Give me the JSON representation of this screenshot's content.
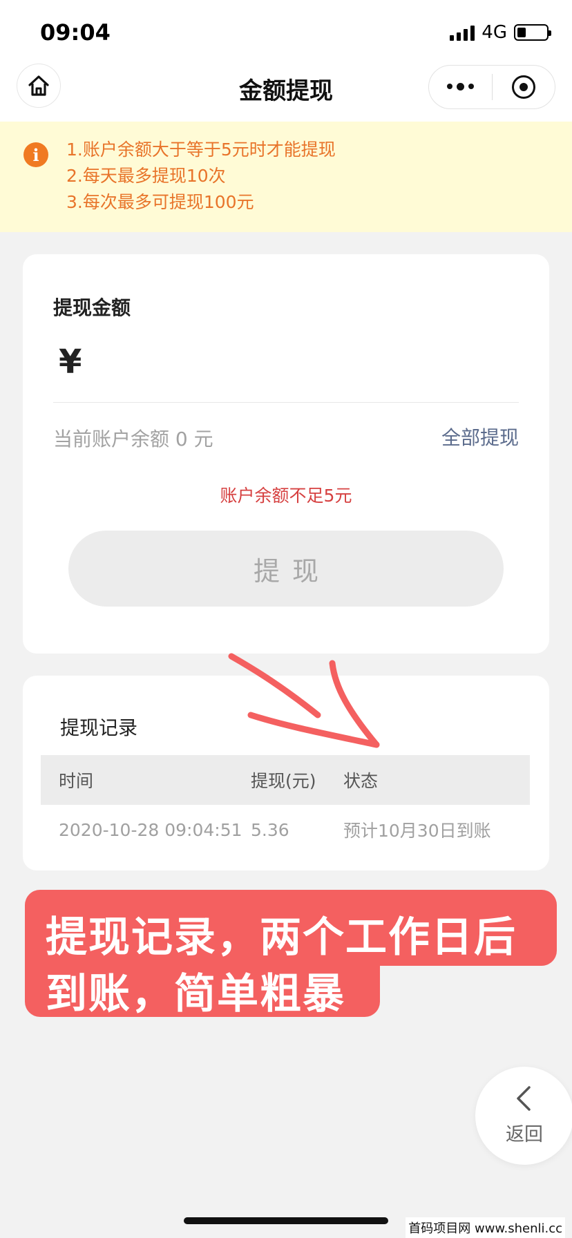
{
  "status_bar": {
    "time": "09:04",
    "network": "4G"
  },
  "nav": {
    "title": "金额提现"
  },
  "notice": {
    "lines": [
      "1.账户余额大于等于5元时才能提现",
      "2.每天最多提现10次",
      "3.每次最多可提现100元"
    ]
  },
  "withdraw": {
    "label": "提现金额",
    "currency_symbol": "¥",
    "amount_value": "",
    "balance_text": "当前账户余额 0 元",
    "withdraw_all": "全部提现",
    "error": "账户余额不足5元",
    "submit_label": "提现"
  },
  "records": {
    "title": "提现记录",
    "headers": [
      "时间",
      "提现(元)",
      "状态"
    ],
    "rows": [
      {
        "time": "2020-10-28 09:04:51",
        "amount": "5.36",
        "status": "预计10月30日到账"
      }
    ]
  },
  "annotation": {
    "line1": "提现记录，两个工作日后",
    "line2": "到账，简单粗暴",
    "color": "#f46060"
  },
  "back": {
    "label": "返回"
  },
  "watermark": "首码项目网 www.shenli.cc"
}
